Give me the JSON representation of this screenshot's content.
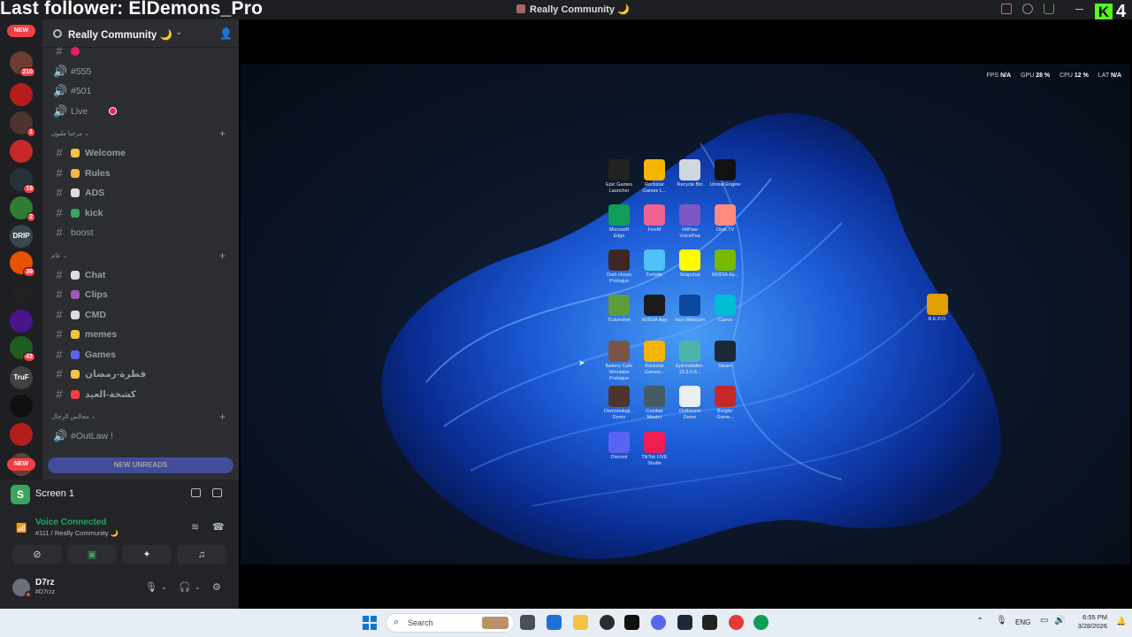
{
  "overlay": {
    "last_follower": "Last follower: ElDemons_Pro",
    "follower_count": "4"
  },
  "window": {
    "title": "Really Community 🌙"
  },
  "server": {
    "name": "Really Community 🌙"
  },
  "guilds": {
    "new_top": "NEW",
    "new_bottom": "NEW",
    "badges": [
      "210",
      "1",
      "19",
      "2",
      "39",
      "42"
    ],
    "items": [
      {
        "color": "#6b3d2e",
        "badge": "210"
      },
      {
        "color": "#b71c1c"
      },
      {
        "color": "#4e342e",
        "badge": "1"
      },
      {
        "color": "#c62828"
      },
      {
        "color": "#263238",
        "badge": "19"
      },
      {
        "color": "#2e7d32",
        "badge": "2"
      },
      {
        "color": "#37474f",
        "text": "DRIP"
      },
      {
        "color": "#e65100",
        "badge": "39"
      },
      {
        "color": "#212121"
      },
      {
        "color": "#4a148c"
      },
      {
        "color": "#1b5e20",
        "badge": "42"
      },
      {
        "color": "#424242",
        "text": "TruF"
      },
      {
        "color": "#101010"
      },
      {
        "color": "#b71c1c"
      },
      {
        "color": "#5d4037"
      }
    ]
  },
  "channels": {
    "top": [
      {
        "icon": "#",
        "label": "",
        "dot": "#e91e63"
      },
      {
        "icon": "🔊",
        "label": "#555"
      },
      {
        "icon": "🔊",
        "label": "#501"
      },
      {
        "icon": "🔊",
        "label": "Live"
      }
    ],
    "cat1": "مرحبا مليون",
    "group1": [
      {
        "icon": "#",
        "label": "Welcome",
        "emoji_color": "#f4c542"
      },
      {
        "icon": "#",
        "label": "Rules",
        "emoji_color": "#f4b942"
      },
      {
        "icon": "#",
        "label": "ADS",
        "emoji_color": "#dddddd"
      },
      {
        "icon": "#",
        "label": "kick",
        "emoji_color": "#3ba55c"
      },
      {
        "icon": "#",
        "label": "boost"
      }
    ],
    "cat2": "عام",
    "group2": [
      {
        "icon": "#",
        "label": "Chat",
        "emoji_color": "#dddddd"
      },
      {
        "icon": "#",
        "label": "Clips",
        "emoji_color": "#9b59b6"
      },
      {
        "icon": "#",
        "label": "CMD",
        "emoji_color": "#dddddd"
      },
      {
        "icon": "#",
        "label": "memes",
        "emoji_color": "#f4c542"
      },
      {
        "icon": "#",
        "label": "Games",
        "emoji_color": "#5865f2"
      },
      {
        "icon": "#",
        "label": "فطرة-رمضان",
        "emoji_color": "#f4c542"
      },
      {
        "icon": "#",
        "label": "كشخة-العيد",
        "emoji_color": "#f23f43"
      }
    ],
    "cat3": "مجالس الرجال",
    "group3": [
      {
        "icon": "🔊",
        "label": "#OutLaw !"
      }
    ],
    "new_unreads": "NEW UNREADS"
  },
  "stream": {
    "name": "Screen 1",
    "voice_status": "Voice Connected",
    "voice_channel": "#111 / Really Community 🌙"
  },
  "user": {
    "name": "D7rz",
    "tag": "#D7rzz"
  },
  "perf": {
    "fps": "N/A",
    "gpu": "28 %",
    "cpu": "12 %",
    "lat": "N/A",
    "fps_label": "FPS",
    "gpu_label": "GPU",
    "cpu_label": "CPU",
    "lat_label": "LAT"
  },
  "desktop_icons": [
    {
      "label": "Epic Games Launcher",
      "color": "#222222"
    },
    {
      "label": "Rockstar Games L...",
      "color": "#f4b400"
    },
    {
      "label": "Recycle Bin",
      "color": "#cfd8dc"
    },
    {
      "label": "Unreal Engine",
      "color": "#111111"
    },
    {
      "label": "Microsoft Edge",
      "color": "#0f9d58"
    },
    {
      "label": "FiveM",
      "color": "#f06292"
    },
    {
      "label": "HitPaw VoicePea",
      "color": "#7e57c2"
    },
    {
      "label": "Ome.TV",
      "color": "#ff8a80"
    },
    {
      "label": "Dark Hours Prologue",
      "color": "#3e2723"
    },
    {
      "label": "Fortnite",
      "color": "#4fc3f7"
    },
    {
      "label": "Snapchat",
      "color": "#fffc00"
    },
    {
      "label": "NVIDIA Ap...",
      "color": "#76b900"
    },
    {
      "label": "TLauncher",
      "color": "#5d9c3a"
    },
    {
      "label": "NVIDIA App",
      "color": "#1b1b1b"
    },
    {
      "label": "Iriun Webcam",
      "color": "#0d47a1"
    },
    {
      "label": "Canva",
      "color": "#00bcd4"
    },
    {
      "label": "Bakery Cafe Simulator Prologue",
      "color": "#795548"
    },
    {
      "label": "Rockstar Games...",
      "color": "#f4b400"
    },
    {
      "label": "EpicInstaller-13.3.0-8...",
      "color": "#4db6ac"
    },
    {
      "label": "Steam",
      "color": "#1b2838"
    },
    {
      "label": "Demonologi... Demo",
      "color": "#4e342e"
    },
    {
      "label": "Combat Master",
      "color": "#455a64"
    },
    {
      "label": "Outbound Demo",
      "color": "#eceff1"
    },
    {
      "label": "Burglin' Gnom...",
      "color": "#c62828"
    },
    {
      "label": "Discord",
      "color": "#5865f2"
    },
    {
      "label": "TikTok LIVE Studio",
      "color": "#ee1d52"
    },
    {
      "label": "R.E.P.O.",
      "color": "#e0a100"
    }
  ],
  "taskbar": {
    "search": "Search",
    "lang": "ENG",
    "time": "6:55 PM",
    "date": "3/28/2026"
  }
}
